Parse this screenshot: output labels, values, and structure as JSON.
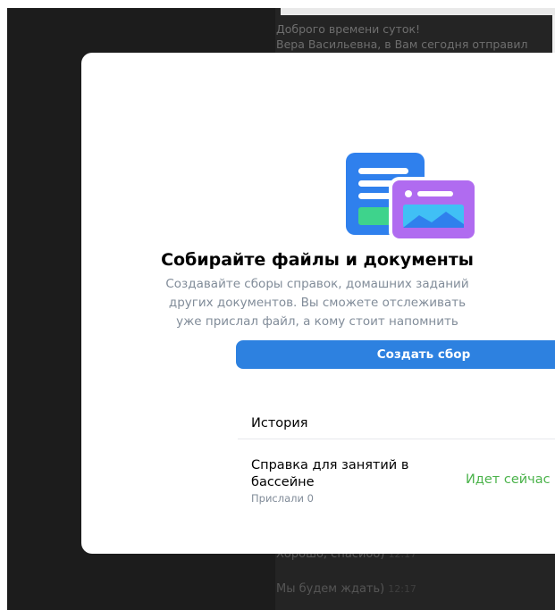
{
  "background": {
    "message_line_1": "Доброго времени суток!",
    "message_line_2": "Вера Васильевна, в Вам сегодня отправил",
    "message_bottom_1": "Хорошо, спасибо)",
    "message_bottom_1_time": "12:17",
    "message_bottom_2": "Мы будем ждать)",
    "message_bottom_2_time": "12:17"
  },
  "modal": {
    "illustration_icon": "documents-illustration-icon",
    "title": "Собирайте файлы и документы",
    "description_lines": [
      "Создавайте сборы справок, домашних заданий",
      "других документов. Вы сможете отслеживать",
      "уже прислал файл, а кому стоит напомнить"
    ],
    "create_button_label": "Создать сбор",
    "history_title": "История",
    "history_items": [
      {
        "title": "Справка для занятий в бассейне",
        "subtitle": "Прислали 0",
        "status": "Идет сейчас"
      }
    ]
  },
  "colors": {
    "accent": "#2d81e0",
    "status_active": "#4bb34b",
    "secondary_text": "#818c99",
    "overlay": "#1c1c1c"
  }
}
